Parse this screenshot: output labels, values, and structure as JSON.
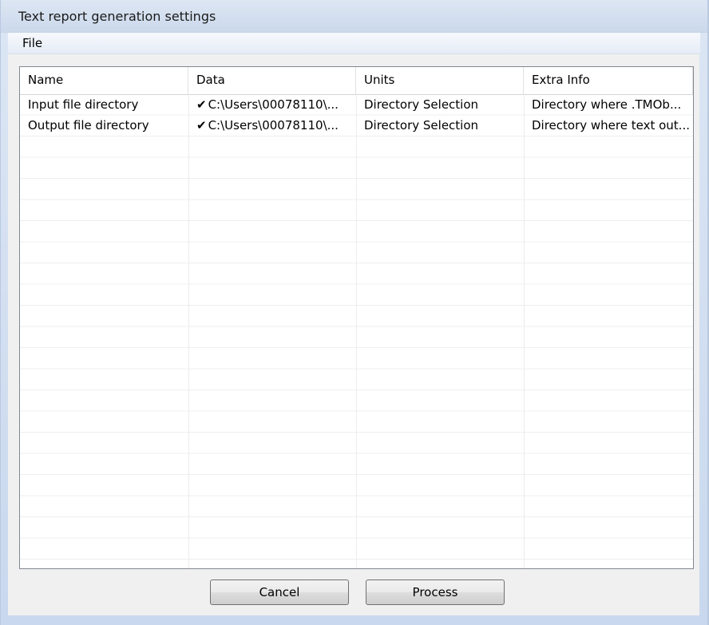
{
  "window": {
    "title": "Text report generation settings"
  },
  "menu": {
    "items": [
      {
        "label": "File"
      }
    ]
  },
  "grid": {
    "columns": [
      {
        "label": "Name"
      },
      {
        "label": "Data"
      },
      {
        "label": "Units"
      },
      {
        "label": "Extra Info"
      }
    ],
    "rows": [
      {
        "name": "Input file directory",
        "data_icon": "checkmark-icon",
        "data": "C:\\Users\\00078110\\...",
        "units": "Directory Selection",
        "extra_info": "Directory where .TMOb..."
      },
      {
        "name": "Output file directory",
        "data_icon": "checkmark-icon",
        "data": "C:\\Users\\00078110\\...",
        "units": "Directory Selection",
        "extra_info": "Directory where text out..."
      }
    ]
  },
  "buttons": {
    "cancel_label": "Cancel",
    "process_label": "Process"
  }
}
